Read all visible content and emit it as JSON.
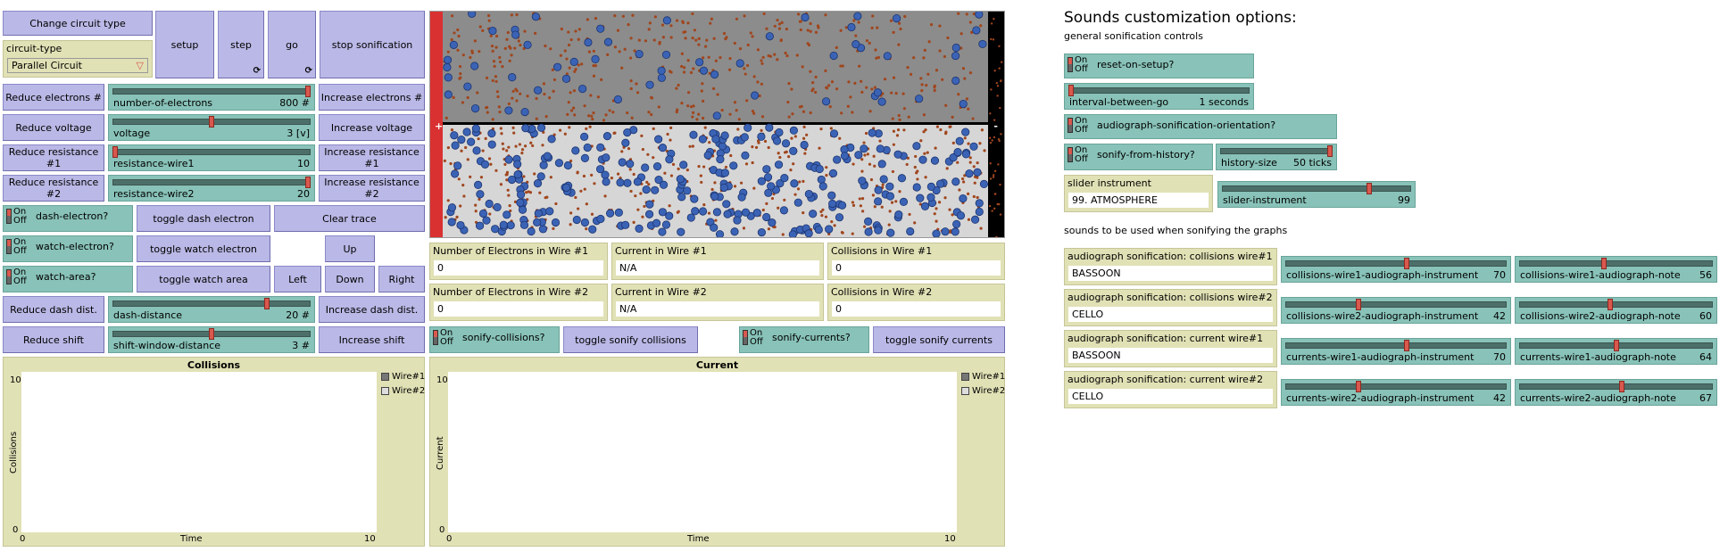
{
  "buttons": {
    "change_circuit_type": "Change circuit type",
    "setup": "setup",
    "step": "step",
    "go": "go",
    "stop_sonification": "stop sonification",
    "reduce_electrons": "Reduce electrons #",
    "increase_electrons": "Increase electrons #",
    "reduce_voltage": "Reduce voltage",
    "increase_voltage": "Increase voltage",
    "reduce_resistance_1": "Reduce resistance #1",
    "increase_resistance_1": "Increase resistance #1",
    "reduce_resistance_2": "Reduce resistance #2",
    "increase_resistance_2": "Increase resistance #2",
    "toggle_dash_electron": "toggle dash electron",
    "clear_trace": "Clear trace",
    "toggle_watch_electron": "toggle watch electron",
    "up": "Up",
    "toggle_watch_area": "toggle watch area",
    "left": "Left",
    "down": "Down",
    "right": "Right",
    "reduce_dash_dist": "Reduce dash dist.",
    "increase_dash_dist": "Increase dash dist.",
    "reduce_shift": "Reduce shift",
    "increase_shift": "Increase shift",
    "toggle_sonify_collisions": "toggle sonify collisions",
    "toggle_sonify_currents": "toggle sonify currents"
  },
  "chooser": {
    "label": "circuit-type",
    "value": "Parallel Circuit"
  },
  "sliders": {
    "number_of_electrons": {
      "label": "number-of-electrons",
      "value": "800 #",
      "fraction": 1.0
    },
    "voltage": {
      "label": "voltage",
      "value": "3 [v]",
      "fraction": 0.5
    },
    "resistance_wire1": {
      "label": "resistance-wire1",
      "value": "10",
      "fraction": 0.0
    },
    "resistance_wire2": {
      "label": "resistance-wire2",
      "value": "20",
      "fraction": 1.0
    },
    "dash_distance": {
      "label": "dash-distance",
      "value": "20 #",
      "fraction": 0.78
    },
    "shift_window_distance": {
      "label": "shift-window-distance",
      "value": "3 #",
      "fraction": 0.5
    },
    "interval_between_go": {
      "label": "interval-between-go",
      "value": "1 seconds",
      "fraction": 0.0
    },
    "history_size": {
      "label": "history-size",
      "value": "50 ticks",
      "fraction": 1.0
    },
    "slider_instrument": {
      "label": "slider-instrument",
      "value": "99",
      "fraction": 0.78
    },
    "c1_instr": {
      "label": "collisions-wire1-audiograph-instrument",
      "value": "70",
      "fraction": 0.55
    },
    "c1_note": {
      "label": "collisions-wire1-audiograph-note",
      "value": "56",
      "fraction": 0.44
    },
    "c2_instr": {
      "label": "collisions-wire2-audiograph-instrument",
      "value": "42",
      "fraction": 0.33
    },
    "c2_note": {
      "label": "collisions-wire2-audiograph-note",
      "value": "60",
      "fraction": 0.47
    },
    "cu1_instr": {
      "label": "currents-wire1-audiograph-instrument",
      "value": "70",
      "fraction": 0.55
    },
    "cu1_note": {
      "label": "currents-wire1-audiograph-note",
      "value": "64",
      "fraction": 0.5
    },
    "cu2_instr": {
      "label": "currents-wire2-audiograph-instrument",
      "value": "42",
      "fraction": 0.33
    },
    "cu2_note": {
      "label": "currents-wire2-audiograph-note",
      "value": "67",
      "fraction": 0.53
    }
  },
  "switches": {
    "on_off": "On\nOff",
    "dash_electron": "dash-electron?",
    "watch_electron": "watch-electron?",
    "watch_area": "watch-area?",
    "sonify_collisions": "sonify-collisions?",
    "sonify_currents": "sonify-currents?",
    "reset_on_setup": "reset-on-setup?",
    "audiograph_orientation": "audiograph-sonification-orientation?",
    "sonify_from_history": "sonify-from-history?"
  },
  "monitors": {
    "electrons_wire1": {
      "label": "Number of Electrons in Wire #1",
      "value": "0"
    },
    "current_wire1": {
      "label": "Current in Wire #1",
      "value": "N/A"
    },
    "collisions_wire1": {
      "label": "Collisions in Wire #1",
      "value": "0"
    },
    "electrons_wire2": {
      "label": "Number of Electrons in Wire #2",
      "value": "0"
    },
    "current_wire2": {
      "label": "Current in Wire #2",
      "value": "N/A"
    },
    "collisions_wire2": {
      "label": "Collisions in Wire #2",
      "value": "0"
    }
  },
  "inputs": {
    "slider_instrument": {
      "label": "slider instrument",
      "value": "99. ATMOSPHERE"
    },
    "coll_wire1": {
      "label": "audiograph sonification: collisions wire#1",
      "value": "BASSOON"
    },
    "coll_wire2": {
      "label": "audiograph sonification: collisions wire#2",
      "value": "CELLO"
    },
    "curr_wire1": {
      "label": "audiograph sonification: current wire#1",
      "value": "BASSOON"
    },
    "curr_wire2": {
      "label": "audiograph sonification: current wire#2",
      "value": "CELLO"
    }
  },
  "plots": {
    "collisions": {
      "title": "Collisions",
      "ylabel": "Collisions",
      "xlabel": "Time",
      "ymax": "10",
      "ymin": "0",
      "xmin": "0",
      "xmax": "10",
      "legend": [
        "Wire#1",
        "Wire#2"
      ]
    },
    "current": {
      "title": "Current",
      "ylabel": "Current",
      "xlabel": "Time",
      "ymax": "10",
      "ymin": "0",
      "xmin": "0",
      "xmax": "10",
      "legend": [
        "Wire#1",
        "Wire#2"
      ]
    }
  },
  "world": {
    "plus": "+",
    "minus": "-"
  },
  "right_panel": {
    "title": "Sounds customization options:",
    "general": "general sonification controls",
    "graphs_note": "sounds to be used when sonifying the graphs"
  },
  "colors": {
    "button": "#bab8e6",
    "slider": "#88c2b8",
    "monitor": "#e1e1b6",
    "wire_top": "#8c8c8c",
    "wire_bottom": "#d6d6d6",
    "electron": "#3b63b5",
    "atom": "#a0461e",
    "terminal": "#d93131"
  }
}
